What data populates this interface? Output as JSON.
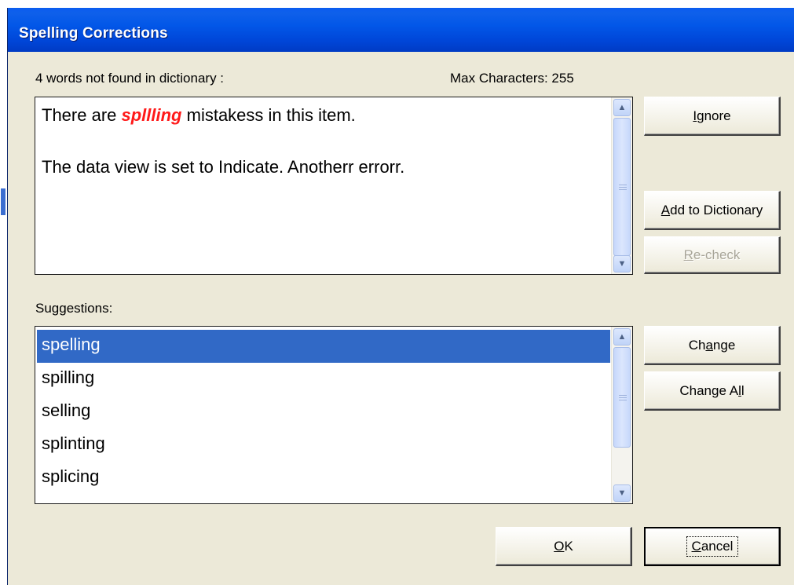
{
  "window": {
    "title": "Spelling Corrections"
  },
  "status": {
    "not_found_text": "4 words not found in dictionary :",
    "max_characters_text": "Max Characters: 255"
  },
  "item_text": {
    "line1_before": "There are ",
    "line1_word": "spllling",
    "line1_after": " mistakess in this item.",
    "line2": "The data view is set to Indicate.  Anotherr errorr."
  },
  "suggestions": {
    "label": "Suggestions:",
    "items": [
      "spelling",
      "spilling",
      "selling",
      "splinting",
      "splicing"
    ],
    "selected_index": 0
  },
  "buttons": {
    "ignore": {
      "pre": "",
      "key": "I",
      "post": "gnore"
    },
    "add_to_dictionary": {
      "pre": "",
      "key": "A",
      "post": "dd to Dictionary"
    },
    "recheck": {
      "pre": "",
      "key": "R",
      "post": "e-check"
    },
    "change": {
      "pre": "Ch",
      "key": "a",
      "post": "nge"
    },
    "change_all": {
      "pre": "Change A",
      "key": "l",
      "post": "l"
    },
    "ok": {
      "pre": "",
      "key": "O",
      "post": "K"
    },
    "cancel": {
      "pre": "",
      "key": "C",
      "post": "ancel"
    }
  },
  "colors": {
    "title_bar": "#0054e3",
    "dialog_bg": "#ece9d8",
    "selection": "#3169c6",
    "misspelled": "#ff1a1a"
  },
  "icons": [
    "scroll-up-arrow-icon",
    "scroll-down-arrow-icon",
    "scroll-grip-icon"
  ]
}
